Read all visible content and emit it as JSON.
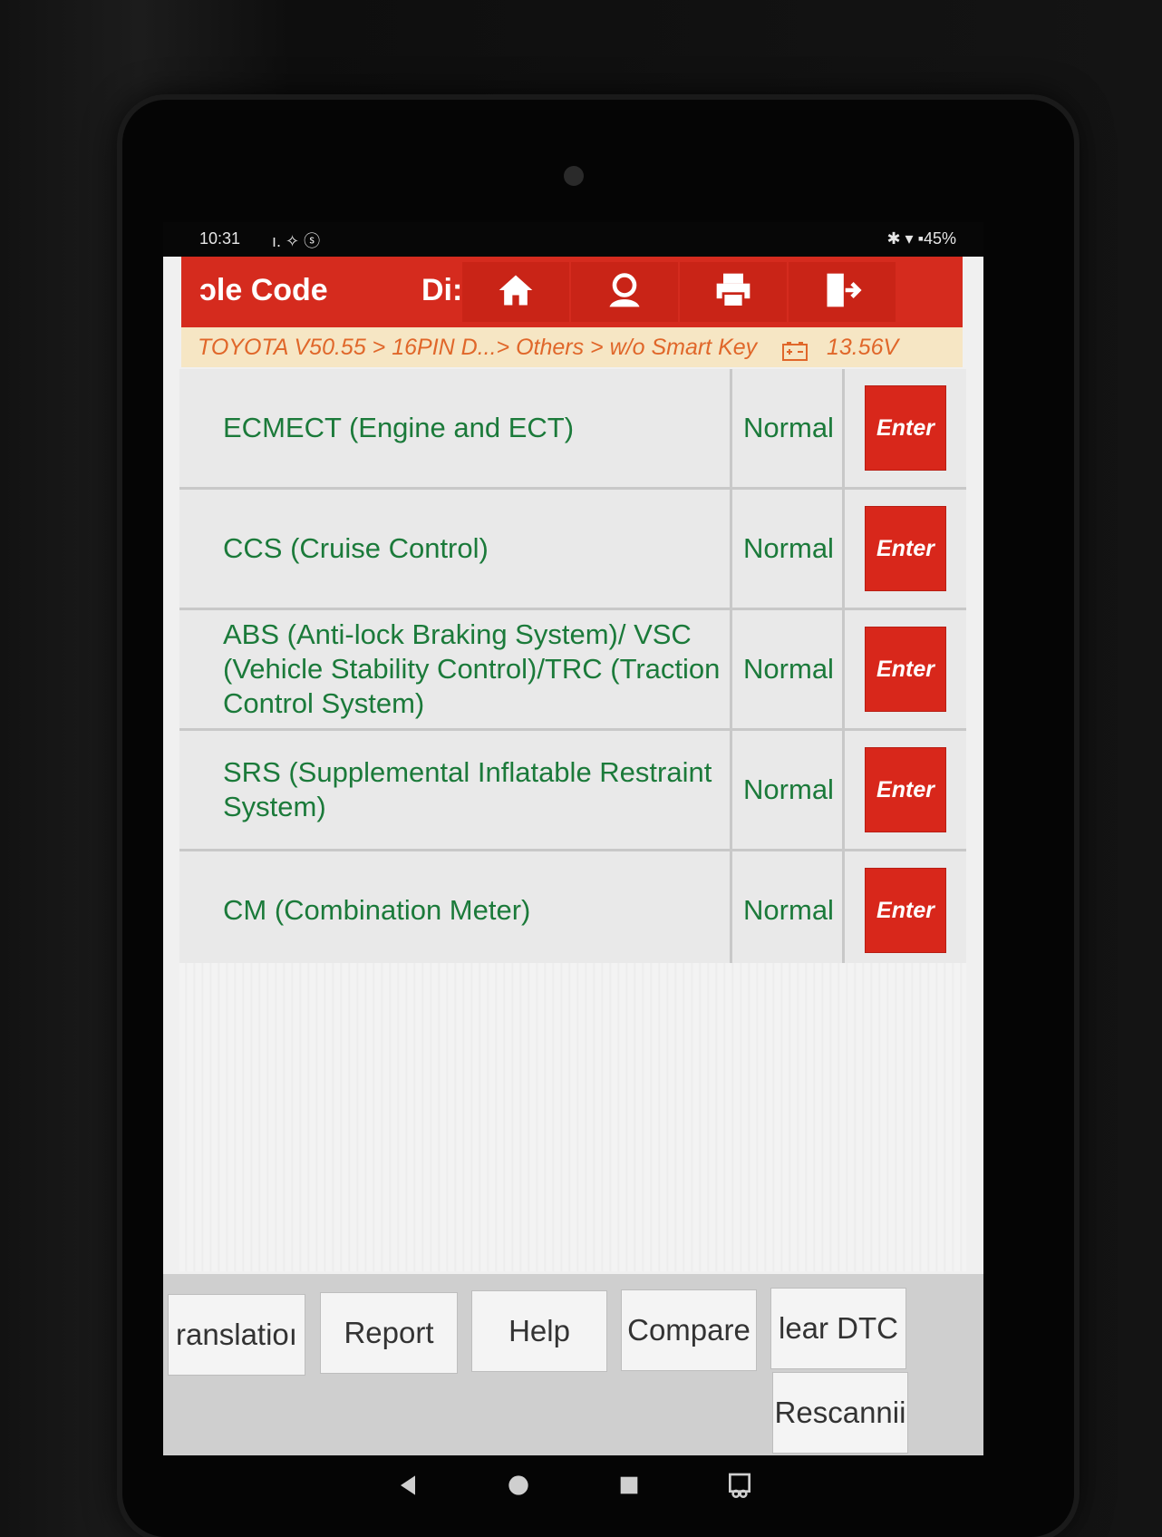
{
  "status_bar": {
    "time": "10:31",
    "left_icons": "ı. ✧ ⓢ",
    "right_text": "✱ ▾ ▪45%"
  },
  "header": {
    "tab_title": "ɔle Code",
    "tab_second": "Di:",
    "icons": [
      "home-icon",
      "user-icon",
      "print-icon",
      "exit-icon"
    ],
    "accent_color": "#d52b1e"
  },
  "breadcrumb": {
    "path": "TOYOTA V50.55 > 16PIN D...> Others > w/o Smart Key",
    "voltage": "13.56V"
  },
  "systems": [
    {
      "name": "ECMECT (Engine and ECT)",
      "status": "Normal",
      "action": "Enter"
    },
    {
      "name": "CCS (Cruise Control)",
      "status": "Normal",
      "action": "Enter"
    },
    {
      "name": "ABS (Anti-lock Braking System)/ VSC (Vehicle Stability Control)/TRC (Traction Control System)",
      "status": "Normal",
      "action": "Enter"
    },
    {
      "name": "SRS (Supplemental Inflatable Restraint System)",
      "status": "Normal",
      "action": "Enter"
    },
    {
      "name": "CM (Combination Meter)",
      "status": "Normal",
      "action": "Enter"
    }
  ],
  "footer": {
    "translation": "ranslatioı",
    "report": "Report",
    "help": "Help",
    "compare": "Compare",
    "clear_dtc": "lear DTC",
    "rescanning": "Rescannii"
  },
  "navbar": [
    "back-icon",
    "home-circle-icon",
    "recents-icon",
    "screenshot-icon"
  ]
}
